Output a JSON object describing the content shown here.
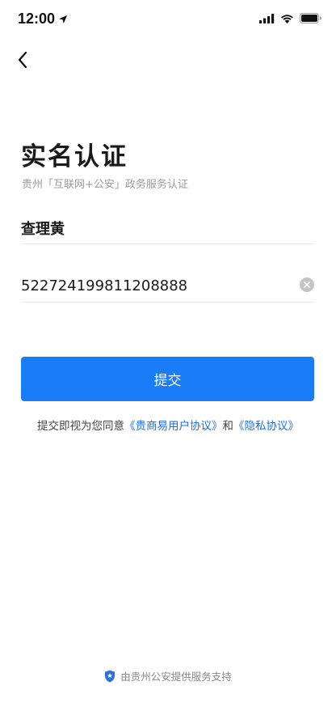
{
  "status_bar": {
    "time": "12:00"
  },
  "title": "实名认证",
  "subtitle": "贵州「互联网+公安」政务服务认证",
  "form": {
    "name_value": "查理黄",
    "id_value": "522724199811208888"
  },
  "submit_label": "提交",
  "agreement": {
    "prefix": "提交即视为您同意",
    "link_user": "《贵商易用户协议》",
    "joiner": "和",
    "link_privacy": "《隐私协议》"
  },
  "footer_text": "由贵州公安提供服务支持",
  "colors": {
    "primary": "#1a7cf7",
    "link": "#1a6fe6",
    "footer_icon": "#2f6fe0"
  }
}
